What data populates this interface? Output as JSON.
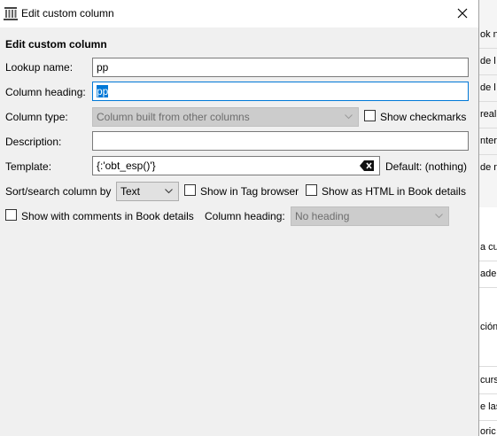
{
  "window": {
    "title": "Edit custom column"
  },
  "form": {
    "heading": "Edit custom column",
    "lookup_name_label": "Lookup name:",
    "lookup_name_value": "pp",
    "column_heading_label": "Column heading:",
    "column_heading_value": "pp",
    "column_type_label": "Column type:",
    "column_type_value": "Column built from other columns",
    "show_checkmarks_label": "Show checkmarks",
    "description_label": "Description:",
    "description_value": "",
    "template_label": "Template:",
    "template_value": "{:'obt_esp()'}",
    "default_label": "Default: (nothing)",
    "sort_label": "Sort/search column by",
    "sort_value": "Text",
    "show_tag_browser_label": "Show in Tag browser",
    "show_html_label": "Show as HTML in Book details",
    "show_comments_label": "Show with comments in Book details",
    "column_heading2_label": "Column heading:",
    "column_heading2_value": "No heading"
  },
  "checkboxes": {
    "show_checkmarks": false,
    "show_tag_browser": false,
    "show_html": false,
    "show_comments": false
  },
  "background": {
    "fragments": [
      "ok no",
      "de l",
      "de l",
      "real",
      "ntero",
      "de n",
      "a cu",
      "ade",
      "ción",
      "curs",
      "e las",
      "oric"
    ]
  }
}
